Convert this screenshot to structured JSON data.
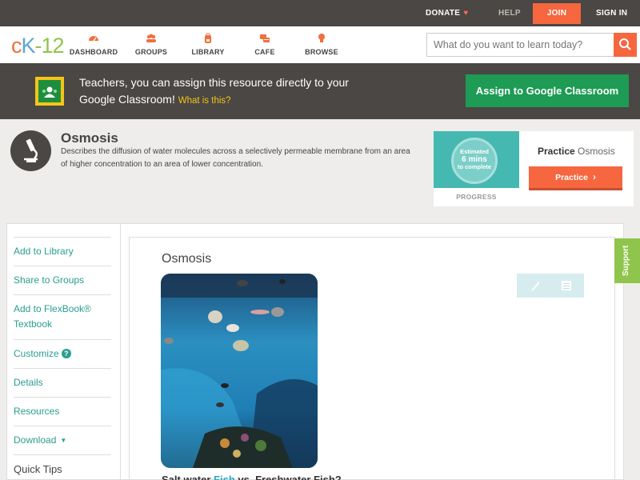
{
  "topbar": {
    "donate": "DONATE",
    "help": "HELP",
    "join": "JOIN",
    "signin": "SIGN IN"
  },
  "nav": {
    "logo": {
      "c": "c",
      "k": "K",
      "dash": "-",
      "num": "12"
    },
    "items": [
      {
        "label": "DASHBOARD",
        "icon": "dashboard-gauge-icon"
      },
      {
        "label": "GROUPS",
        "icon": "groups-people-icon"
      },
      {
        "label": "LIBRARY",
        "icon": "library-backpack-icon"
      },
      {
        "label": "CAFE",
        "icon": "cafe-chat-icon"
      },
      {
        "label": "BROWSE",
        "icon": "browse-lightbulb-icon"
      }
    ],
    "search_placeholder": "What do you want to learn today?"
  },
  "banner": {
    "text": "Teachers, you can assign this resource directly to your Google Classroom!",
    "what": "What is this?",
    "assign_button": "Assign to Google Classroom"
  },
  "concept": {
    "title": "Osmosis",
    "description": "Describes the diffusion of water molecules across a selectively permeable membrane from an area of higher concentration to an area of lower concentration."
  },
  "practice": {
    "estimated": "Estimated",
    "mins": "6 mins",
    "to_complete": "to complete",
    "progress_label": "PROGRESS",
    "title_bold": "Practice",
    "title_rest": "Osmosis",
    "button": "Practice"
  },
  "sidebar": {
    "add_library": "Add to Library",
    "share_groups": "Share to Groups",
    "add_flexbook": "Add to FlexBook® Textbook",
    "customize": "Customize",
    "details": "Details",
    "resources": "Resources",
    "download": "Download",
    "quick_tips": "Quick Tips"
  },
  "content": {
    "title": "Osmosis",
    "support": "Support",
    "cut_heading_a": "Salt water Fish vs. Freshwater Fish?",
    "cut_visible_1": "Salt",
    "cut_visible_hl": "Fish",
    "cut_visible_2": "vs. Freshwater Fish?"
  },
  "colors": {
    "accent_orange": "#f6663f",
    "accent_green": "#1e9b54",
    "link_teal": "#2a9d8f",
    "dark_bar": "#4a4744"
  }
}
